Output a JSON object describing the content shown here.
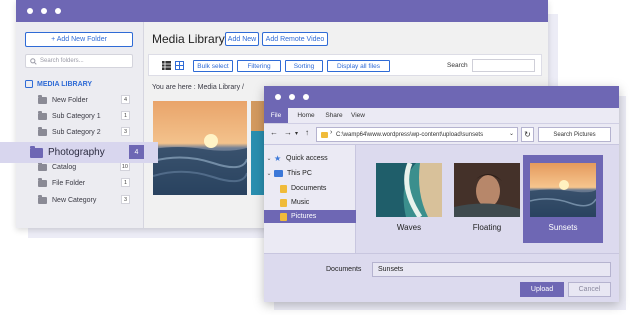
{
  "media_library": {
    "add_folder_label": "+ Add New Folder",
    "search_placeholder": "Search folders...",
    "library_label": "MEDIA LIBRARY",
    "folders": [
      {
        "name": "New Folder",
        "count": "4"
      },
      {
        "name": "Sub Category 1",
        "count": "1"
      },
      {
        "name": "Sub Category 2",
        "count": "3"
      },
      {
        "name": "Catalog",
        "count": "10"
      },
      {
        "name": "File Folder",
        "count": "1"
      },
      {
        "name": "New Category",
        "count": "3"
      }
    ],
    "highlight": {
      "name": "Photography",
      "count": "4"
    },
    "title": "Media Library",
    "add_new_label": "Add New",
    "add_remote_label": "Add Remote Video",
    "toolbar": {
      "bulk_select": "Bulk select",
      "filtering": "Filtering",
      "sorting": "Sorting",
      "display_all": "Display all files",
      "search_label": "Search"
    },
    "breadcrumb": "You are here :  Media Library  /"
  },
  "file_dialog": {
    "menu": [
      "File",
      "Home",
      "Share",
      "View"
    ],
    "address": "C:\\wamp64\\www.wordpress\\wp-content\\upload\\sunsets",
    "search_placeholder": "Search Pictures",
    "nav": {
      "quick_access": "Quick access",
      "this_pc": "This PC",
      "items": [
        "Documents",
        "Music",
        "Pictures"
      ]
    },
    "files": [
      {
        "name": "Waves"
      },
      {
        "name": "Floating"
      },
      {
        "name": "Sunsets"
      }
    ],
    "filename_label": "Documents",
    "filename_value": "Sunsets",
    "upload_label": "Upload",
    "cancel_label": "Cancel"
  },
  "colors": {
    "accent": "#6e67b4",
    "link_blue": "#2f6bd6",
    "folder_yellow": "#f0bb3a"
  }
}
